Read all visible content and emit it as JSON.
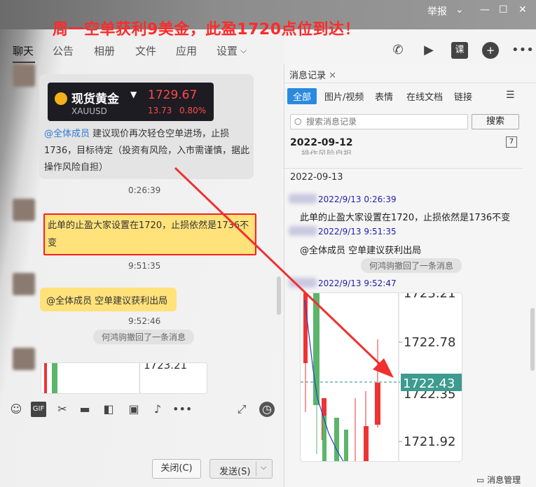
{
  "headline": "周一空单获利9美金，此盈1720点位到达！",
  "window": {
    "report_label": "举报",
    "min": "—",
    "max": "☐",
    "close": "✕"
  },
  "tabs": [
    "聊天",
    "公告",
    "相册",
    "文件",
    "应用",
    "设置"
  ],
  "quote": {
    "name": "现货黄金",
    "symbol": "XAUUSD",
    "price": "1729.67",
    "change": "13.73",
    "pct": "0.80%"
  },
  "chat": {
    "msg1_at": "@全体成员",
    "msg1_text": " 建议现价再次轻仓空单进场，止损1736，目标待定（投资有风险，入市需谨慎，据此操作风险自担）",
    "time1": "0:26:39",
    "msg2_text": "此单的止盈大家设置在1720，止损依然是1736不变",
    "time2": "9:51:35",
    "msg3_text": "@全体成员 空单建议获利出局",
    "time3": "9:52:46",
    "recall": "何鸿驹撤回了一条消息",
    "thumb_price": "1723.21"
  },
  "toolbar": {
    "gif": "GIF"
  },
  "buttons": {
    "close": "关闭(C)",
    "send": "发送(S)"
  },
  "history": {
    "tab_title": "消息记录",
    "filters": [
      "全部",
      "图片/视频",
      "表情",
      "在线文档",
      "链接"
    ],
    "search_placeholder": "搜索消息记录",
    "search_button": "搜索",
    "date1": "2022-09-12",
    "cutoff_text": "操作风险自担",
    "date2": "2022-09-13",
    "t1": "2022/9/13 0:26:39",
    "m1": "此单的止盈大家设置在1720，止损依然是1736不变",
    "t2": "2022/9/13 9:51:35",
    "m2": "@全体成员 空单建议获利出局",
    "recall": "何鸿驹撤回了一条消息",
    "t3": "2022/9/13 9:52:47",
    "manage": "消息管理"
  },
  "chart_data": {
    "type": "candlestick",
    "y_ticks": [
      "1723.21",
      "1722.78",
      "1722.35",
      "1721.92"
    ],
    "current_price": "1722.43"
  }
}
